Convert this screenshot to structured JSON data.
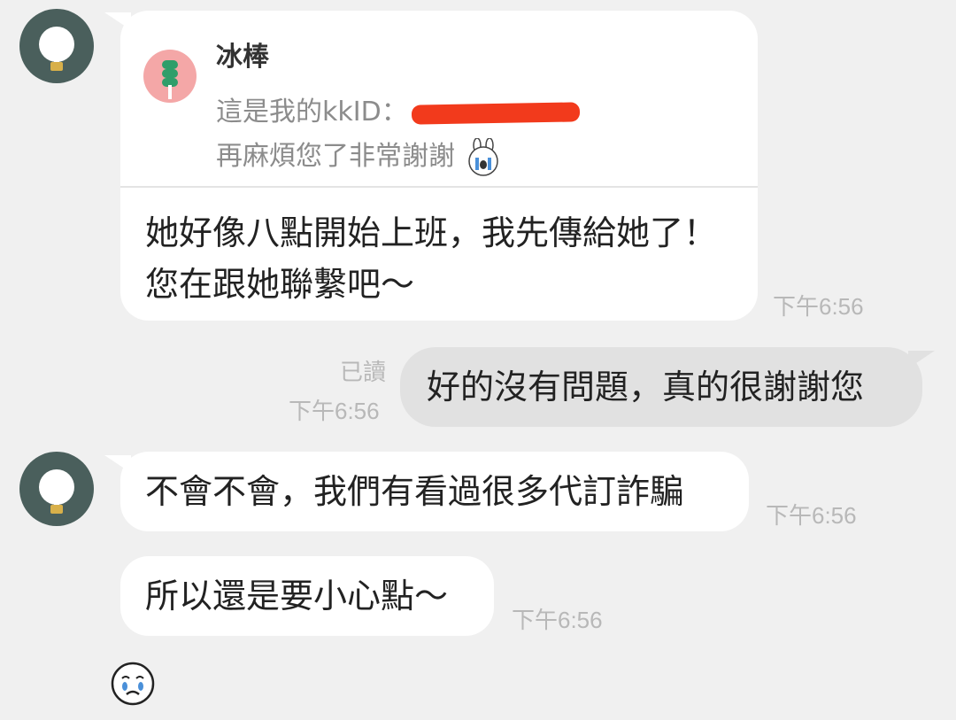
{
  "colors": {
    "background": "#f0f0f0",
    "incoming_bubble": "#ffffff",
    "outgoing_bubble": "#e1e1e1",
    "timestamp": "#b8b8b8",
    "avatar_bg": "#4a5f5c",
    "redaction": "#f23a1c"
  },
  "messages": {
    "m1": {
      "reply": {
        "name": "冰棒",
        "line1_prefix": "這是我的kkID：",
        "line2": "再麻煩您了非常謝謝",
        "sticker_icon": "crying-bunny-icon"
      },
      "text": "她好像八點開始上班，我先傳給她了！您在跟她聯繫吧～",
      "time": "下午6:56"
    },
    "m2": {
      "text": "好的沒有問題，真的很謝謝您",
      "read": "已讀",
      "time": "下午6:56"
    },
    "m3": {
      "text": "不會不會，我們有看過很多代訂詐騙",
      "time": "下午6:56"
    },
    "m4": {
      "text": "所以還是要小心點～",
      "time": "下午6:56"
    },
    "m5": {
      "emoji_icon": "crying-face-emoji-icon"
    }
  }
}
